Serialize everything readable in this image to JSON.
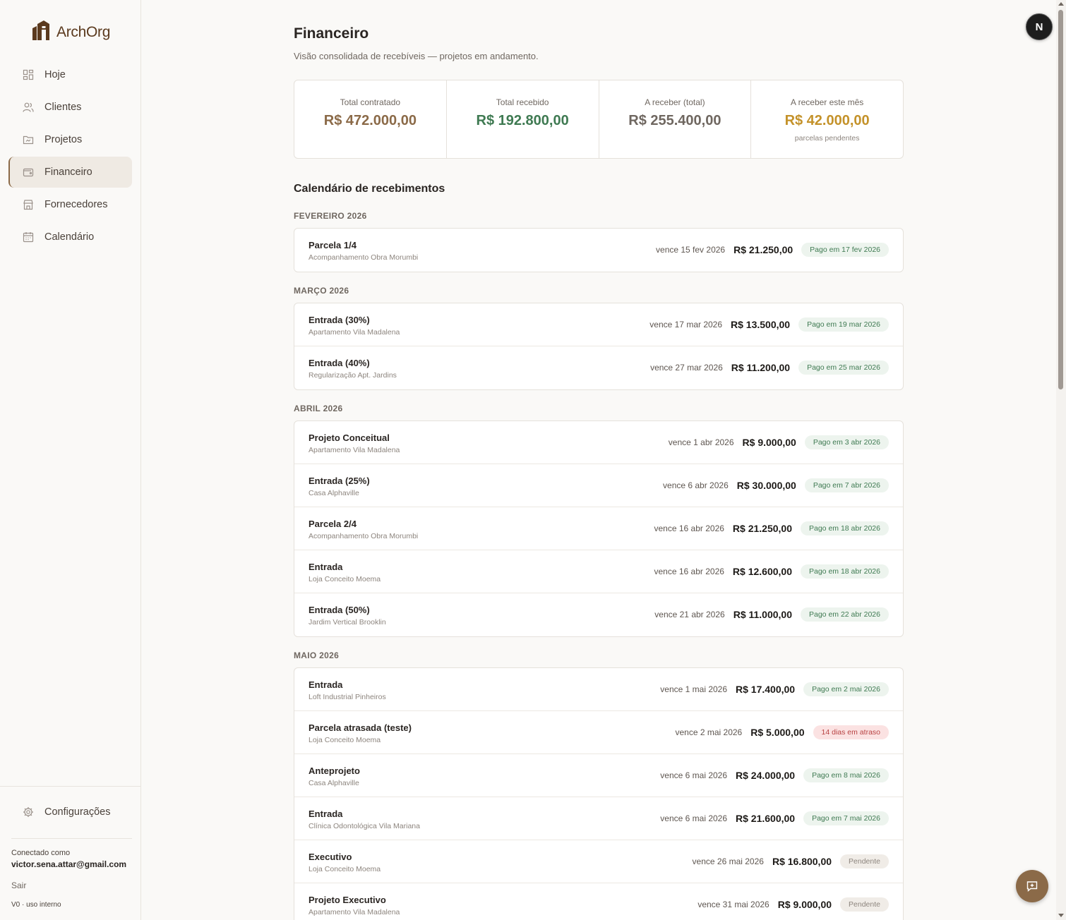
{
  "app": {
    "name": "ArchOrg"
  },
  "sidebar": {
    "items": [
      {
        "label": "Hoje",
        "icon": "grid-icon"
      },
      {
        "label": "Clientes",
        "icon": "users-icon"
      },
      {
        "label": "Projetos",
        "icon": "folder-icon"
      },
      {
        "label": "Financeiro",
        "icon": "wallet-icon",
        "active": true
      },
      {
        "label": "Fornecedores",
        "icon": "store-icon"
      },
      {
        "label": "Calendário",
        "icon": "calendar-icon"
      }
    ],
    "settings_label": "Configurações",
    "connected_label": "Conectado como",
    "email": "victor.sena.attar@gmail.com",
    "logout_label": "Sair",
    "version": "V0 · uso interno"
  },
  "page": {
    "title": "Financeiro",
    "subtitle": "Visão consolidada de recebíveis — projetos em andamento."
  },
  "stats": [
    {
      "label": "Total contratado",
      "value": "R$ 472.000,00",
      "color": "#8b6a48",
      "hint": ""
    },
    {
      "label": "Total recebido",
      "value": "R$ 192.800,00",
      "color": "#3f7a52",
      "hint": ""
    },
    {
      "label": "A receber (total)",
      "value": "R$ 255.400,00",
      "color": "#6f6760",
      "hint": ""
    },
    {
      "label": "A receber este mês",
      "value": "R$ 42.000,00",
      "color": "#c4922a",
      "hint": "parcelas pendentes"
    }
  ],
  "calendar": {
    "title": "Calendário de recebimentos",
    "months": [
      {
        "label": "FEVEREIRO 2026",
        "rows": [
          {
            "title": "Parcela 1/4",
            "project": "Acompanhamento Obra Morumbi",
            "due": "vence 15 fev 2026",
            "amount": "R$ 21.250,00",
            "status": "Pago em 17 fev 2026",
            "kind": "paid"
          }
        ]
      },
      {
        "label": "MARÇO 2026",
        "rows": [
          {
            "title": "Entrada (30%)",
            "project": "Apartamento Vila Madalena",
            "due": "vence 17 mar 2026",
            "amount": "R$ 13.500,00",
            "status": "Pago em 19 mar 2026",
            "kind": "paid"
          },
          {
            "title": "Entrada (40%)",
            "project": "Regularização Apt. Jardins",
            "due": "vence 27 mar 2026",
            "amount": "R$ 11.200,00",
            "status": "Pago em 25 mar 2026",
            "kind": "paid"
          }
        ]
      },
      {
        "label": "ABRIL 2026",
        "rows": [
          {
            "title": "Projeto Conceitual",
            "project": "Apartamento Vila Madalena",
            "due": "vence 1 abr 2026",
            "amount": "R$ 9.000,00",
            "status": "Pago em 3 abr 2026",
            "kind": "paid"
          },
          {
            "title": "Entrada (25%)",
            "project": "Casa Alphaville",
            "due": "vence 6 abr 2026",
            "amount": "R$ 30.000,00",
            "status": "Pago em 7 abr 2026",
            "kind": "paid"
          },
          {
            "title": "Parcela 2/4",
            "project": "Acompanhamento Obra Morumbi",
            "due": "vence 16 abr 2026",
            "amount": "R$ 21.250,00",
            "status": "Pago em 18 abr 2026",
            "kind": "paid"
          },
          {
            "title": "Entrada",
            "project": "Loja Conceito Moema",
            "due": "vence 16 abr 2026",
            "amount": "R$ 12.600,00",
            "status": "Pago em 18 abr 2026",
            "kind": "paid"
          },
          {
            "title": "Entrada (50%)",
            "project": "Jardim Vertical Brooklin",
            "due": "vence 21 abr 2026",
            "amount": "R$ 11.000,00",
            "status": "Pago em 22 abr 2026",
            "kind": "paid"
          }
        ]
      },
      {
        "label": "MAIO 2026",
        "rows": [
          {
            "title": "Entrada",
            "project": "Loft Industrial Pinheiros",
            "due": "vence 1 mai 2026",
            "amount": "R$ 17.400,00",
            "status": "Pago em 2 mai 2026",
            "kind": "paid"
          },
          {
            "title": "Parcela atrasada (teste)",
            "project": "Loja Conceito Moema",
            "due": "vence 2 mai 2026",
            "amount": "R$ 5.000,00",
            "status": "14 dias em atraso",
            "kind": "late"
          },
          {
            "title": "Anteprojeto",
            "project": "Casa Alphaville",
            "due": "vence 6 mai 2026",
            "amount": "R$ 24.000,00",
            "status": "Pago em 8 mai 2026",
            "kind": "paid"
          },
          {
            "title": "Entrada",
            "project": "Clínica Odontológica Vila Mariana",
            "due": "vence 6 mai 2026",
            "amount": "R$ 21.600,00",
            "status": "Pago em 7 mai 2026",
            "kind": "paid"
          },
          {
            "title": "Executivo",
            "project": "Loja Conceito Moema",
            "due": "vence 26 mai 2026",
            "amount": "R$ 16.800,00",
            "status": "Pendente",
            "kind": "pending"
          },
          {
            "title": "Projeto Executivo",
            "project": "Apartamento Vila Madalena",
            "due": "vence 31 mai 2026",
            "amount": "R$ 9.000,00",
            "status": "Pendente",
            "kind": "pending"
          }
        ]
      }
    ]
  },
  "user": {
    "avatar_letter": "N"
  },
  "chat_icon": "chat-icon"
}
